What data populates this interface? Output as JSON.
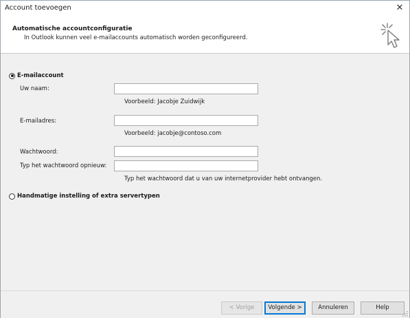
{
  "window": {
    "title": "Account toevoegen",
    "close_symbol": "✕"
  },
  "header": {
    "title": "Automatische accountconfiguratie",
    "subtitle": "In Outlook kunnen veel e-mailaccounts automatisch worden geconfigureerd.",
    "icon": "wizard-cursor-icon"
  },
  "options": {
    "email_account": {
      "label": "E-mailaccount",
      "selected": true
    },
    "manual": {
      "label": "Handmatige instelling of extra servertypen",
      "selected": false
    }
  },
  "form": {
    "name": {
      "label": "Uw naam:",
      "value": "",
      "hint": "Voorbeeld: Jacobje Zuidwijk"
    },
    "email": {
      "label": "E-mailadres:",
      "value": "",
      "hint": "Voorbeeld: jacobje@contoso.com"
    },
    "password": {
      "label": "Wachtwoord:",
      "value": ""
    },
    "password_confirm": {
      "label": "Typ het wachtwoord opnieuw:",
      "value": "",
      "hint": "Typ het wachtwoord dat u van uw internetprovider hebt ontvangen."
    }
  },
  "buttons": {
    "back": "< Vorige",
    "next": "Volgende >",
    "cancel": "Annuleren",
    "help": "Help"
  },
  "colors": {
    "dialog_background": "#f0f0f0",
    "default_button_border": "#0078d7"
  }
}
